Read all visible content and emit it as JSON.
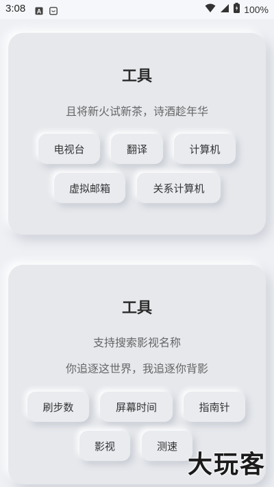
{
  "status_bar": {
    "time": "3:08",
    "battery": "100%",
    "left_icons": [
      "a-box-icon",
      "smile-box-icon"
    ],
    "right_icons": [
      "wifi-icon",
      "signal-icon",
      "battery-icon"
    ]
  },
  "cards": [
    {
      "title": "工具",
      "subtitles": [
        "且将新火试新茶，诗酒趁年华"
      ],
      "buttons": [
        "电视台",
        "翻译",
        "计算机",
        "虚拟邮箱",
        "关系计算机"
      ]
    },
    {
      "title": "工具",
      "subtitles": [
        "支持搜索影视名称",
        "你追逐这世界，我追逐你背影"
      ],
      "buttons": [
        "刷步数",
        "屏幕时间",
        "指南针",
        "影视",
        "测速"
      ]
    }
  ],
  "watermark": "大玩客"
}
